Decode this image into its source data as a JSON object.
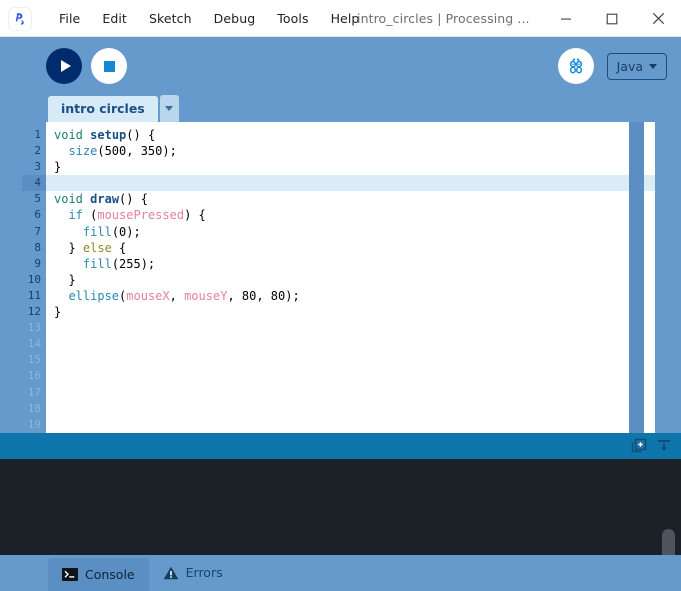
{
  "window": {
    "app_icon": "processing-logo-icon",
    "document_title": "intro_circles | Processing ...",
    "minimize_label": "minimize-icon",
    "maximize_label": "maximize-icon",
    "close_label": "close-icon"
  },
  "menubar": {
    "items": [
      {
        "label": "File"
      },
      {
        "label": "Edit"
      },
      {
        "label": "Sketch"
      },
      {
        "label": "Debug"
      },
      {
        "label": "Tools"
      },
      {
        "label": "Help"
      }
    ]
  },
  "toolbar": {
    "run_label": "Run",
    "stop_label": "Stop",
    "debug_label": "Debug",
    "mode_label": "Java"
  },
  "tabs": {
    "sketch_tab_label": "intro circles",
    "tab_menu_label": "tab-menu"
  },
  "editor": {
    "line_numbers": [
      "1",
      "2",
      "3",
      "4",
      "5",
      "6",
      "7",
      "8",
      "9",
      "10",
      "11",
      "12",
      "13",
      "14",
      "15",
      "16",
      "17",
      "18",
      "19"
    ],
    "active_line_count": 12,
    "current_line": 4,
    "lines": [
      {
        "n": "1",
        "text": "void setup() {"
      },
      {
        "n": "2",
        "text": "  size(500, 350);"
      },
      {
        "n": "3",
        "text": "}"
      },
      {
        "n": "4",
        "text": ""
      },
      {
        "n": "5",
        "text": "void draw() {"
      },
      {
        "n": "6",
        "text": "  if (mousePressed) {"
      },
      {
        "n": "7",
        "text": "    fill(0);"
      },
      {
        "n": "8",
        "text": "  } else {"
      },
      {
        "n": "9",
        "text": "    fill(255);"
      },
      {
        "n": "10",
        "text": "  }"
      },
      {
        "n": "11",
        "text": "  ellipse(mouseX, mouseY, 80, 80);"
      },
      {
        "n": "12",
        "text": "}"
      }
    ]
  },
  "console_header": {
    "copy_icon": "new-window-icon",
    "scroll_to_end_icon": "scroll-to-end-icon"
  },
  "console": {
    "output": ""
  },
  "bottom_tabs": {
    "items": [
      {
        "label": "Console",
        "icon": "terminal-icon",
        "active": true
      },
      {
        "label": "Errors",
        "icon": "warning-icon",
        "active": false
      }
    ]
  },
  "colors": {
    "toolbar_blue": "#6699cc",
    "run_button": "#002c6d",
    "stop_square": "#1389d4",
    "console_header": "#0f76ab",
    "console_body": "#1c2127",
    "tab_active": "#d6eaf8",
    "current_line_highlight": "#dbecf9"
  }
}
